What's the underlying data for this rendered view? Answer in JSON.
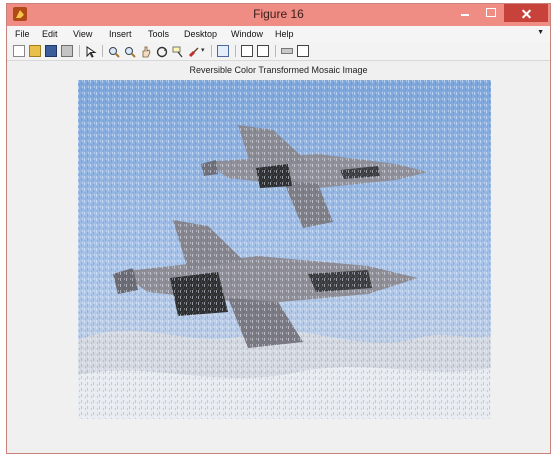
{
  "window": {
    "title": "Figure 16",
    "buttons": {
      "minimize": "minimize",
      "maximize": "maximize",
      "close": "close"
    }
  },
  "menu": {
    "items": [
      "File",
      "Edit",
      "View",
      "Insert",
      "Tools",
      "Desktop",
      "Window",
      "Help"
    ],
    "overflow_icon": "chevron-down-icon"
  },
  "toolbar": {
    "icons": [
      "new-figure-icon",
      "open-file-icon",
      "save-icon",
      "print-icon",
      "edit-plot-icon",
      "zoom-in-icon",
      "zoom-out-icon",
      "pan-icon",
      "rotate-3d-icon",
      "data-cursor-icon",
      "brush-icon",
      "link-plot-icon",
      "colorbar-icon",
      "legend-icon",
      "hide-plot-tools-icon",
      "show-plot-tools-icon"
    ]
  },
  "axes": {
    "title": "Reversible Color Transformed Mosaic Image"
  },
  "image": {
    "subject": "two-fighter-jets-over-clouds",
    "colors": {
      "sky": "#8fb5e4",
      "clouds": "#cfd5e0",
      "jet_body": "#8f8e96",
      "jet_shadow": "#2e3032"
    }
  }
}
